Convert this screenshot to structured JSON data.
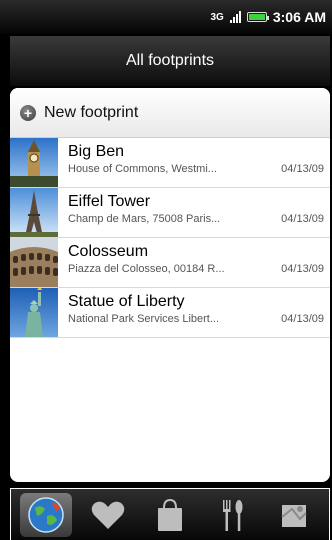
{
  "status": {
    "network": "3G",
    "time": "3:06 AM",
    "icons": [
      "signal-icon",
      "battery-icon"
    ]
  },
  "header": {
    "title": "All footprints"
  },
  "new_footprint": {
    "label": "New footprint",
    "icon": "plus-icon"
  },
  "footprints": [
    {
      "title": "Big Ben",
      "address": "House of Commons, Westmi...",
      "date": "04/13/09",
      "thumb": "big-ben-icon"
    },
    {
      "title": "Eiffel Tower",
      "address": "Champ de Mars, 75008 Paris...",
      "date": "04/13/09",
      "thumb": "eiffel-tower-icon"
    },
    {
      "title": "Colosseum",
      "address": "Piazza del Colosseo, 00184 R...",
      "date": "04/13/09",
      "thumb": "colosseum-icon"
    },
    {
      "title": "Statue of Liberty",
      "address": "National Park Services Libert...",
      "date": "04/13/09",
      "thumb": "statue-of-liberty-icon"
    }
  ],
  "tabs": [
    {
      "name": "globe-icon",
      "active": true
    },
    {
      "name": "heart-icon",
      "active": false
    },
    {
      "name": "shopping-bag-icon",
      "active": false
    },
    {
      "name": "fork-knife-icon",
      "active": false
    },
    {
      "name": "map-icon",
      "active": false
    }
  ]
}
